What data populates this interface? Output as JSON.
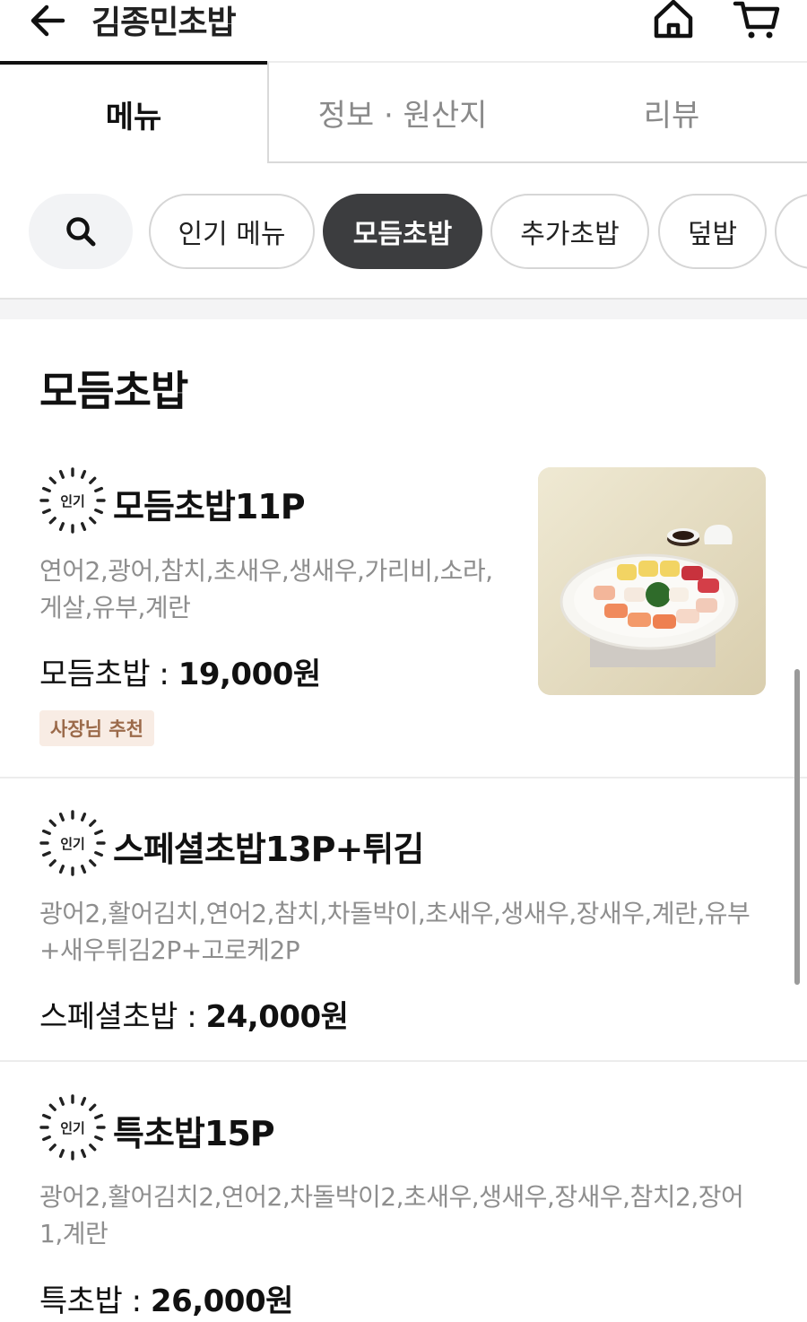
{
  "header": {
    "title": "김종민초밥",
    "back_icon": "arrow-left-icon",
    "home_icon": "home-icon",
    "cart_icon": "cart-icon"
  },
  "tabs": [
    {
      "label": "메뉴",
      "active": true
    },
    {
      "label": "정보 · 원산지",
      "active": false
    },
    {
      "label": "리뷰",
      "active": false
    }
  ],
  "categories": {
    "search_icon": "search-icon",
    "chips": [
      {
        "label": "인기 메뉴",
        "active": false
      },
      {
        "label": "모듬초밥",
        "active": true
      },
      {
        "label": "추가초밥",
        "active": false
      },
      {
        "label": "덮밥",
        "active": false
      }
    ]
  },
  "section": {
    "title": "모듬초밥"
  },
  "badge_label": "인기",
  "items": [
    {
      "name": "모듬초밥11P",
      "description": "연어2,광어,참치,초새우,생새우,가리비,소라,게살,유부,계란",
      "price_label": "모듬초밥 : ",
      "price": "19,000원",
      "tag": "사장님 추천",
      "has_image": true
    },
    {
      "name": "스페셜초밥13P+튀김",
      "description": "광어2,활어김치,연어2,참치,차돌박이,초새우,생새우,장새우,계란,유부+새우튀김2P+고로케2P",
      "price_label": "스페셜초밥 : ",
      "price": "24,000원"
    },
    {
      "name": "특초밥15P",
      "description": "광어2,활어김치2,연어2,차돌박이2,초새우,생새우,장새우,참치2,장어1,계란",
      "price_label": "특초밥 : ",
      "price": "26,000원"
    }
  ],
  "colors": {
    "active_chip": "#3c3d3f",
    "tag_bg": "#f8ece4",
    "tag_text": "#9b6a4a"
  }
}
